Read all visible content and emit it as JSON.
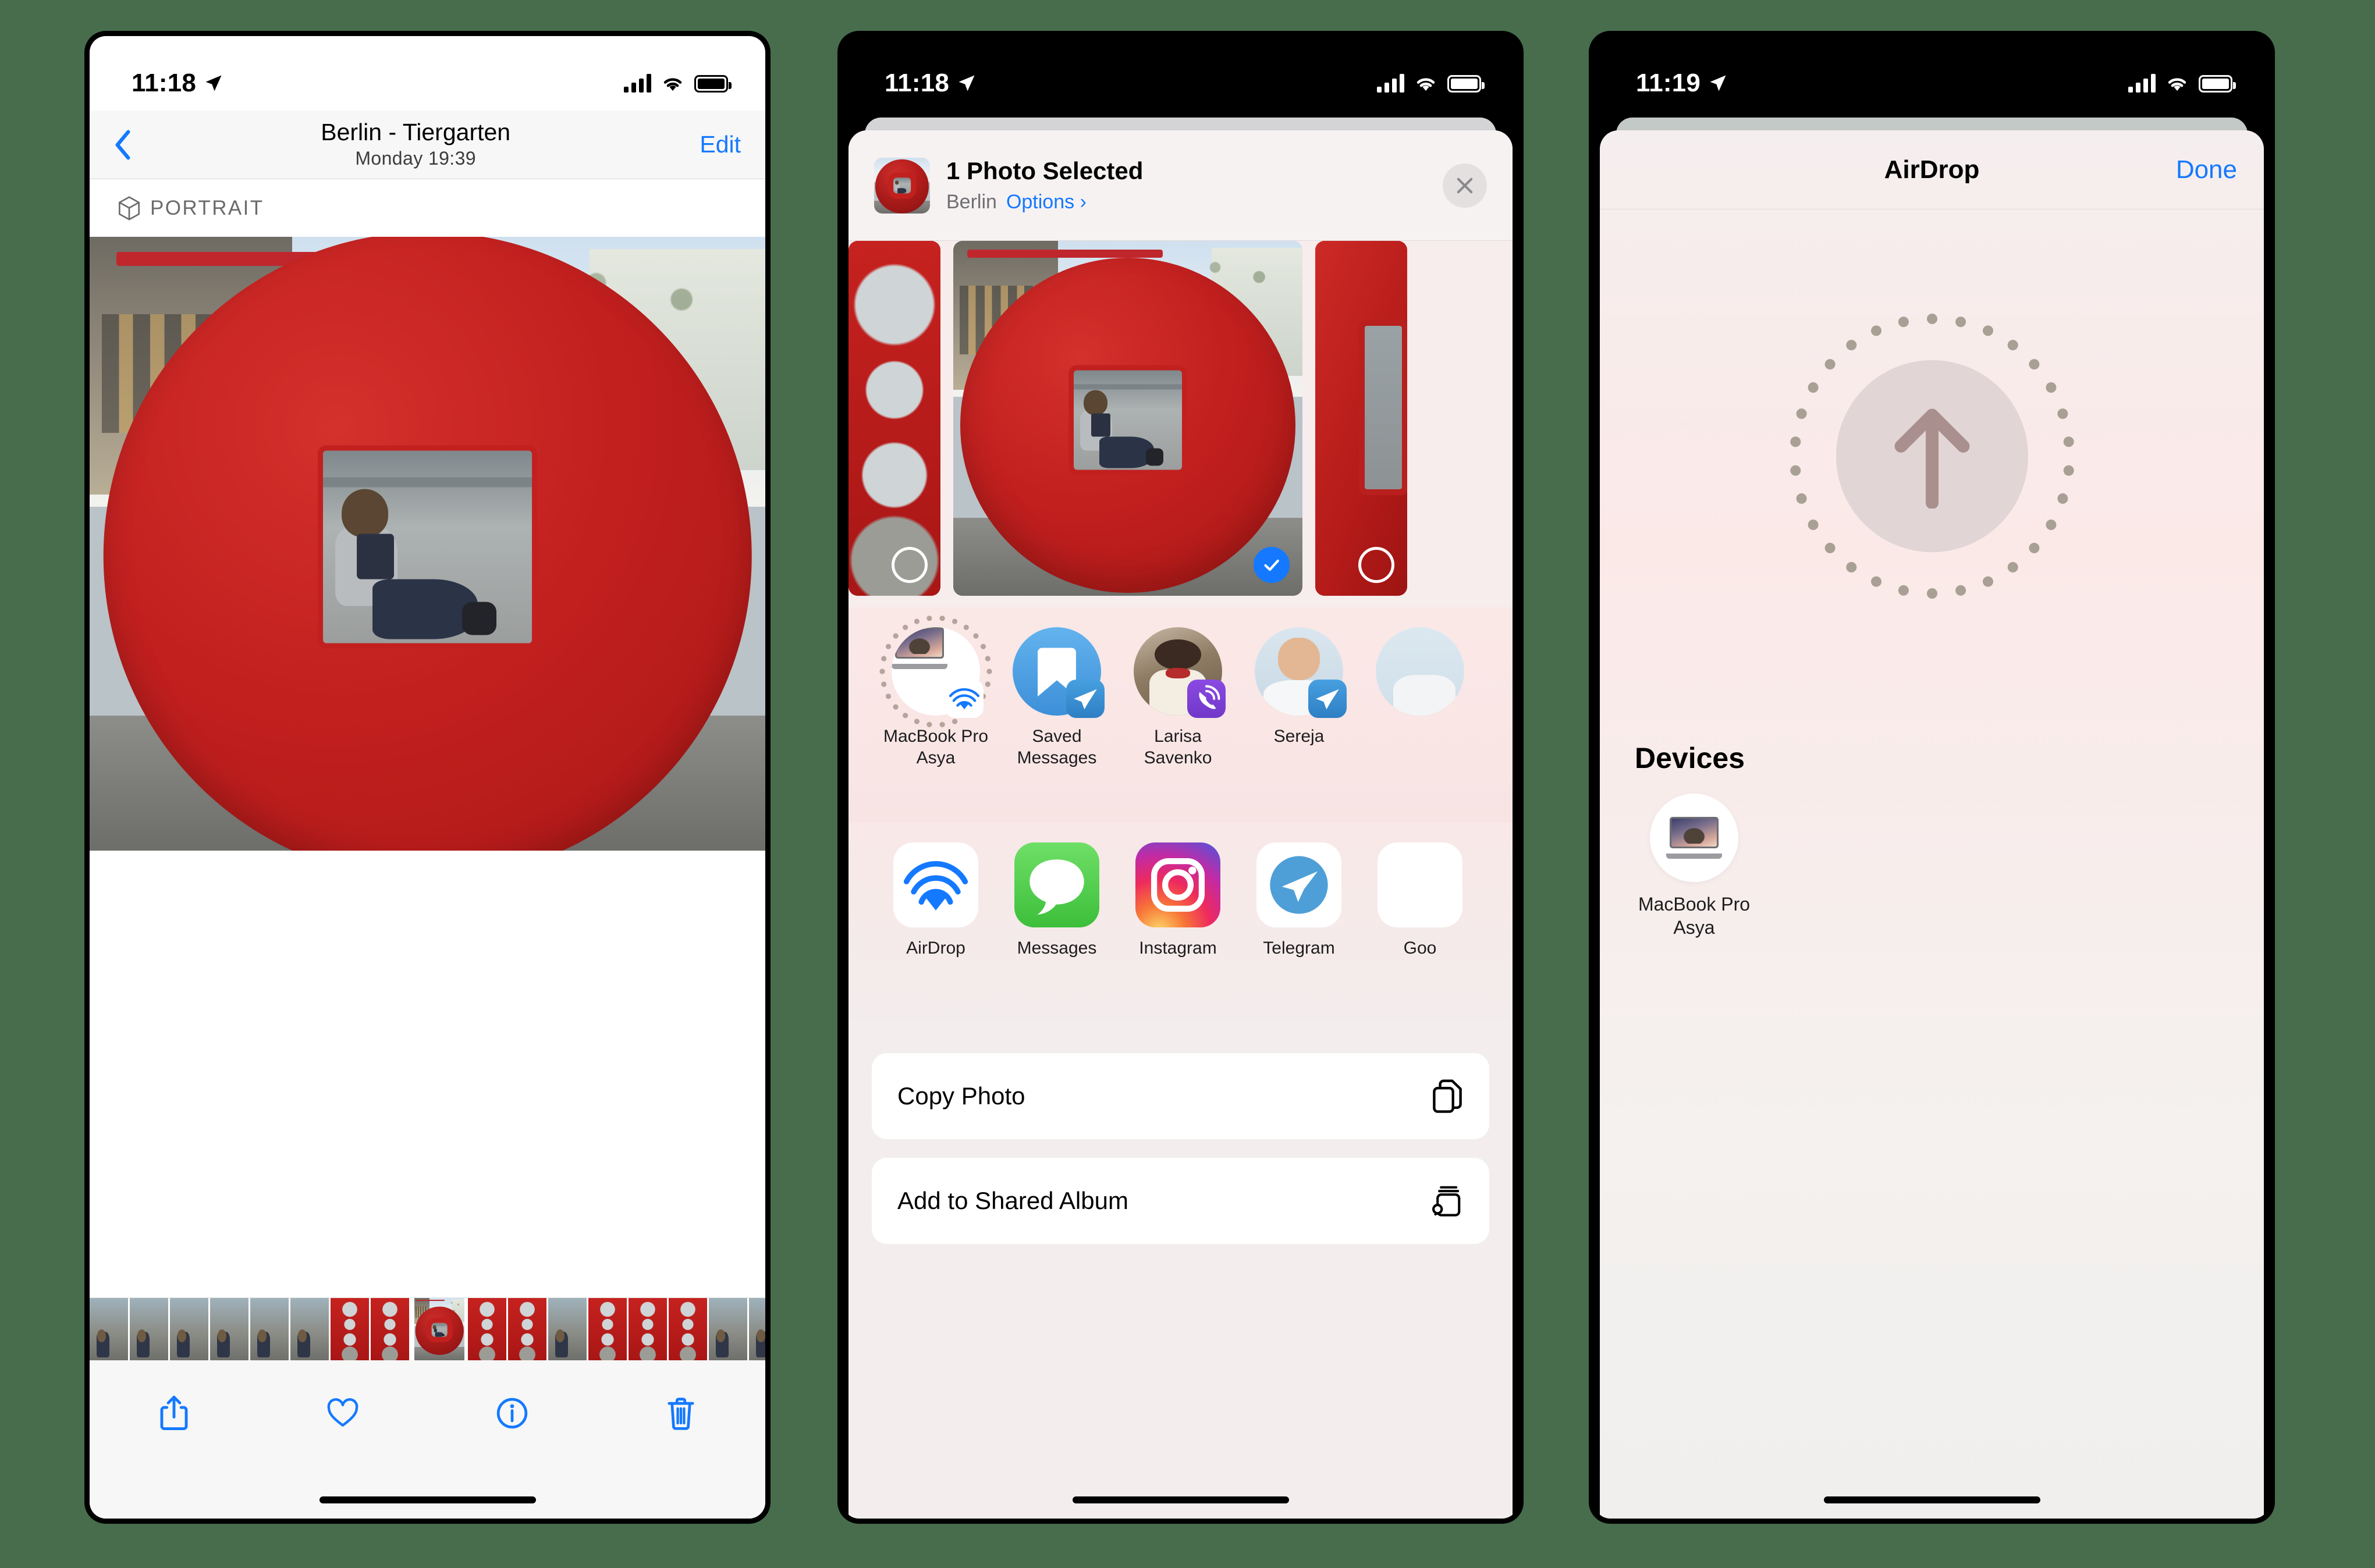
{
  "background_color": "#476d4d",
  "accent_blue": "#1479ff",
  "phone1": {
    "statusbar": {
      "time": "11:18",
      "location_icon": "location-arrow-icon",
      "cellular_icon": "cellular-bars-icon",
      "wifi_icon": "wifi-icon",
      "battery_icon": "battery-icon"
    },
    "nav": {
      "back_icon": "chevron-left-icon",
      "title": "Berlin - Tiergarten",
      "subtitle": "Monday  19:39",
      "edit_label": "Edit"
    },
    "badge": {
      "icon": "cube-icon",
      "label": "PORTRAIT"
    },
    "toolbar": [
      {
        "name": "share-button",
        "icon": "share-icon"
      },
      {
        "name": "favorite-button",
        "icon": "heart-icon"
      },
      {
        "name": "info-button",
        "icon": "info-circle-icon"
      },
      {
        "name": "delete-button",
        "icon": "trash-icon"
      }
    ]
  },
  "phone2": {
    "statusbar": {
      "time": "11:18",
      "location_icon": "location-arrow-icon",
      "cellular_icon": "cellular-bars-icon",
      "wifi_icon": "wifi-icon",
      "battery_icon": "battery-icon"
    },
    "header": {
      "title": "1 Photo Selected",
      "location": "Berlin",
      "options_label": "Options",
      "options_chevron": "chevron-right-icon",
      "close_icon": "close-icon"
    },
    "carousel": [
      {
        "selected": false
      },
      {
        "selected": true
      },
      {
        "selected": false
      }
    ],
    "contacts": [
      {
        "label_line1": "MacBook Pro",
        "label_line2": "Asya",
        "avatar": "macbook-pro-avatar",
        "badge": "airdrop-badge-icon"
      },
      {
        "label_line1": "Saved",
        "label_line2": "Messages",
        "avatar": "telegram-saved-messages-avatar",
        "badge": "telegram-badge-icon"
      },
      {
        "label_line1": "Larisa",
        "label_line2": "Savenko",
        "avatar": "contact-photo-avatar",
        "badge": "viber-badge-icon"
      },
      {
        "label_line1": "Sereja",
        "label_line2": "",
        "avatar": "contact-photo-avatar",
        "badge": "telegram-badge-icon"
      },
      {
        "label_line1": "",
        "label_line2": "",
        "avatar": "contact-photo-avatar",
        "badge": ""
      }
    ],
    "apps": [
      {
        "label": "AirDrop",
        "icon": "airdrop-icon"
      },
      {
        "label": "Messages",
        "icon": "messages-icon"
      },
      {
        "label": "Instagram",
        "icon": "instagram-icon"
      },
      {
        "label": "Telegram",
        "icon": "telegram-icon"
      },
      {
        "label": "Goo",
        "icon": "google-icon"
      }
    ],
    "actions": [
      {
        "label": "Copy Photo",
        "icon": "copy-icon"
      },
      {
        "label": "Add to Shared Album",
        "icon": "shared-album-icon"
      }
    ]
  },
  "phone3": {
    "statusbar": {
      "time": "11:19",
      "location_icon": "location-arrow-icon",
      "cellular_icon": "cellular-bars-icon",
      "wifi_icon": "wifi-icon",
      "battery_icon": "battery-icon"
    },
    "header": {
      "title": "AirDrop",
      "done_label": "Done"
    },
    "radar": {
      "icon": "arrow-up-icon"
    },
    "devices_heading": "Devices",
    "devices": [
      {
        "label_line1": "MacBook Pro",
        "label_line2": "Asya",
        "avatar": "macbook-pro-avatar"
      }
    ]
  }
}
